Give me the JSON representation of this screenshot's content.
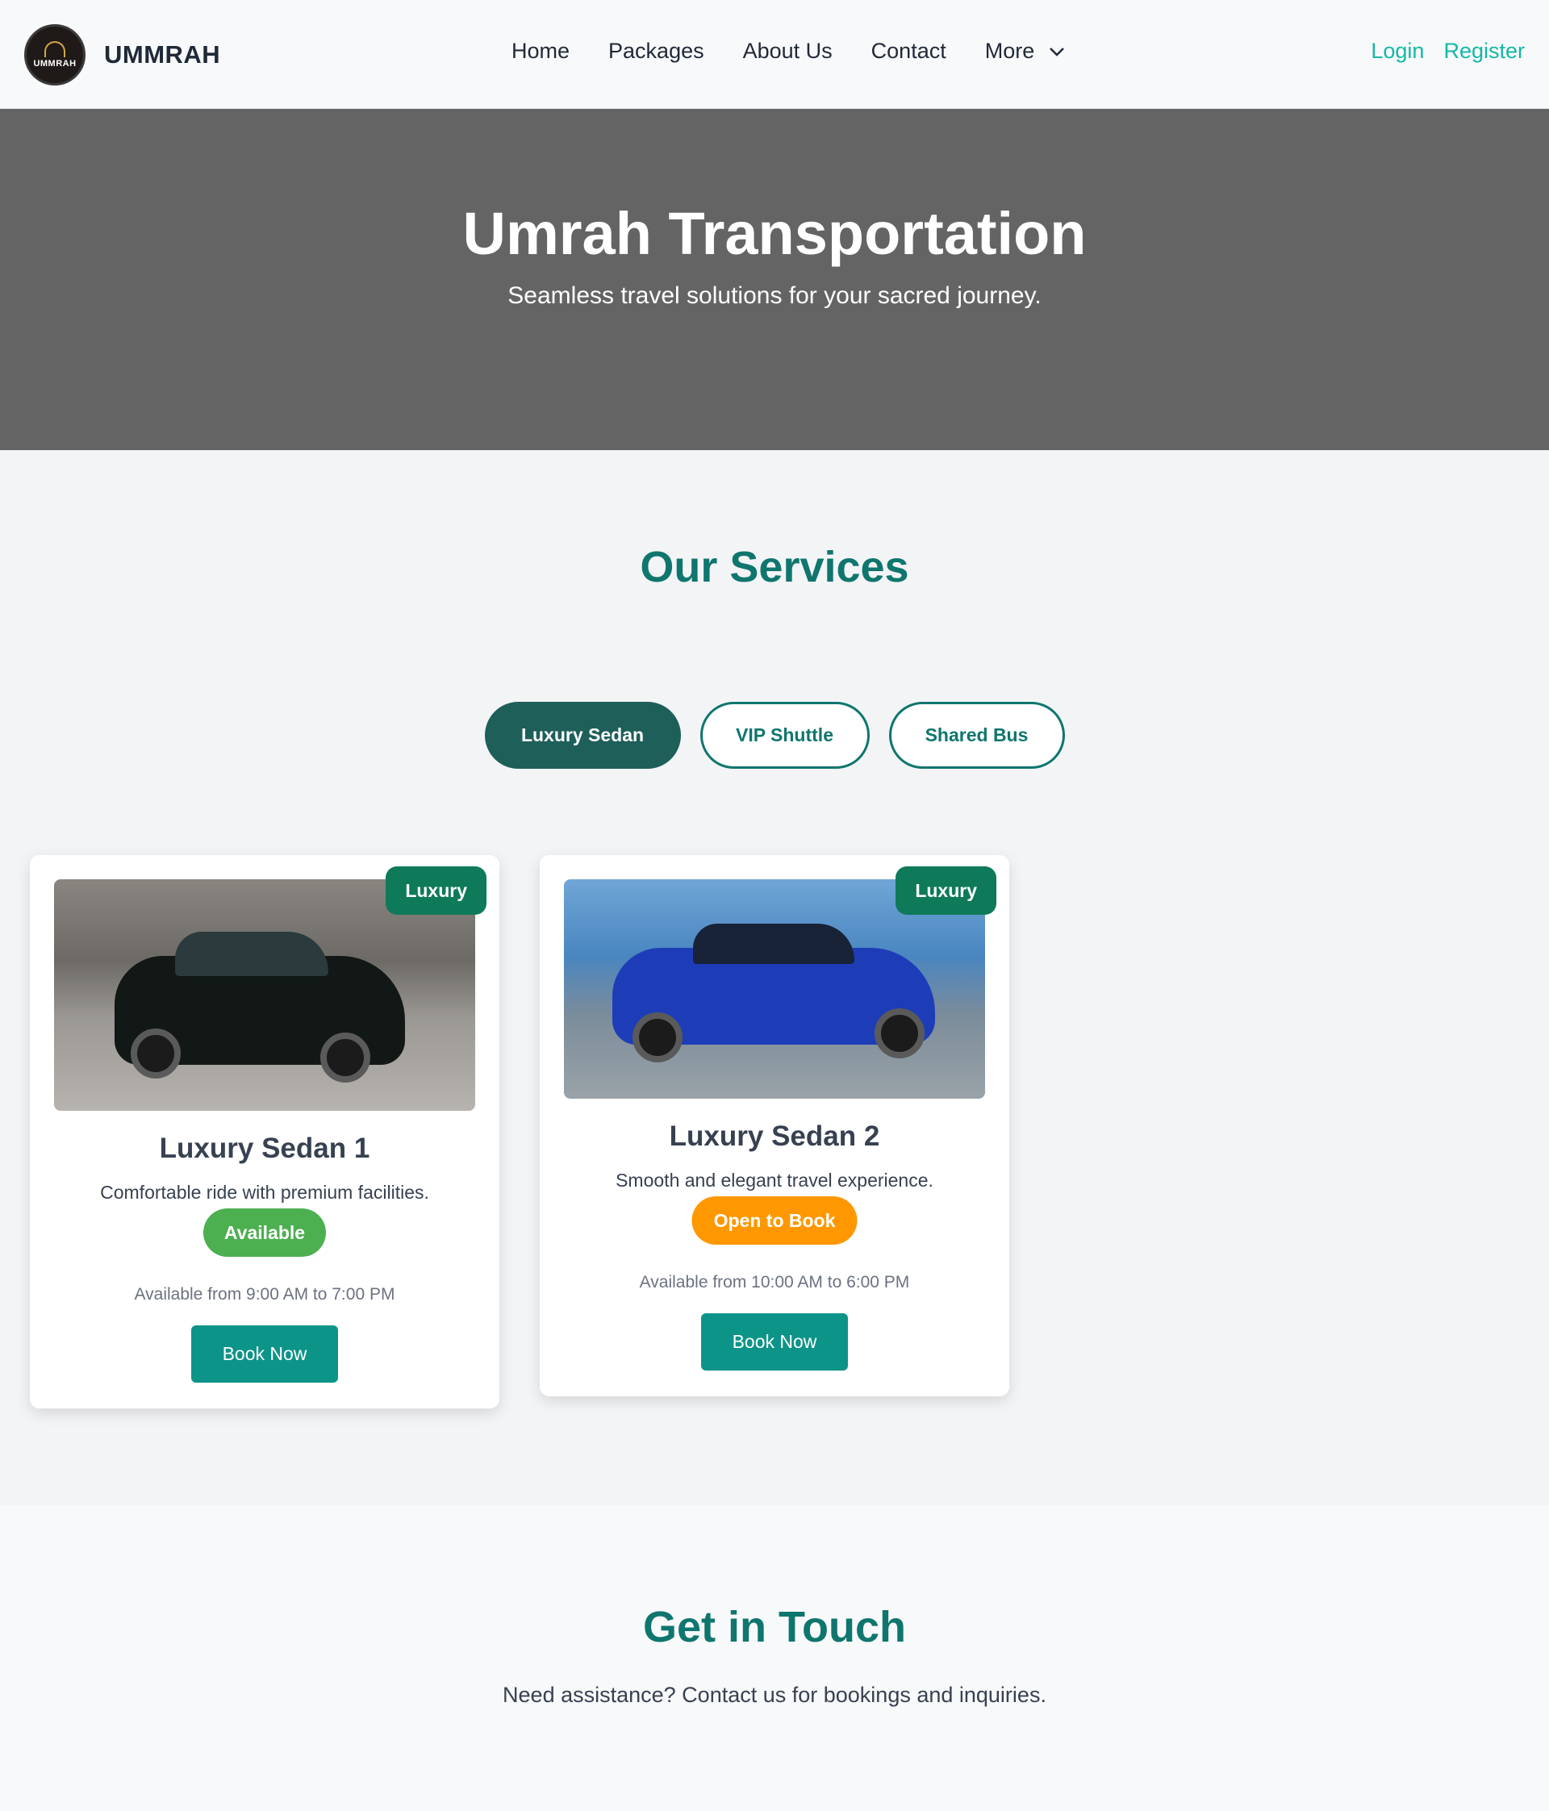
{
  "header": {
    "logo_text": "UMMRAH",
    "brand": "UMMRAH",
    "nav": [
      {
        "label": "Home"
      },
      {
        "label": "Packages"
      },
      {
        "label": "About Us"
      },
      {
        "label": "Contact"
      },
      {
        "label": "More"
      }
    ],
    "login": "Login",
    "register": "Register"
  },
  "hero": {
    "title": "Umrah Transportation",
    "subtitle": "Seamless travel solutions for your sacred journey."
  },
  "services": {
    "title": "Our Services",
    "tabs": [
      {
        "label": "Luxury Sedan",
        "active": true
      },
      {
        "label": "VIP Shuttle",
        "active": false
      },
      {
        "label": "Shared Bus",
        "active": false
      }
    ],
    "cards": [
      {
        "badge": "Luxury",
        "title": "Luxury Sedan 1",
        "description": "Comfortable ride with premium facilities.",
        "status": "Available",
        "status_color": "#4caf50",
        "hours": "Available from 9:00 AM to 7:00 PM",
        "button": "Book Now"
      },
      {
        "badge": "Luxury",
        "title": "Luxury Sedan 2",
        "description": "Smooth and elegant travel experience.",
        "status": "Open to Book",
        "status_color": "#ff9800",
        "hours": "Available from 10:00 AM to 6:00 PM",
        "button": "Book Now"
      }
    ]
  },
  "contact": {
    "title": "Get in Touch",
    "text": "Need assistance? Contact us for bookings and inquiries."
  },
  "colors": {
    "accent": "#0f766e",
    "button": "#0d9488",
    "link": "#14b8a6",
    "hero_bg": "#646464"
  }
}
